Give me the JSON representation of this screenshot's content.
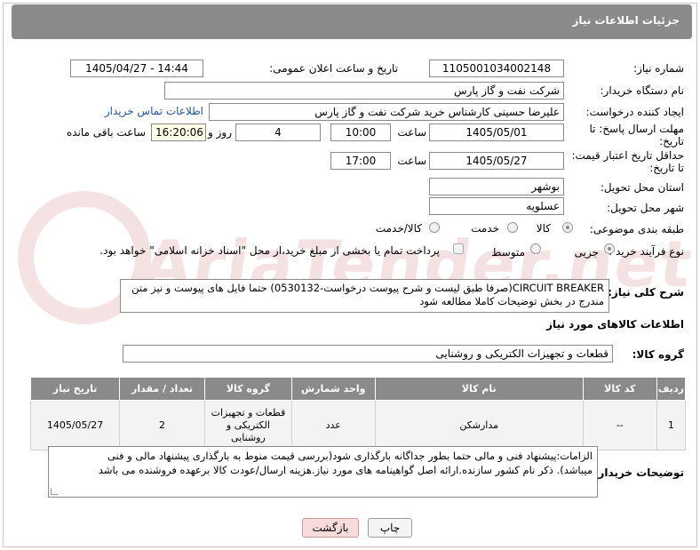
{
  "header": {
    "title": "جزئیات اطلاعات نیاز"
  },
  "watermark": {
    "text": "AriaTender.net"
  },
  "form": {
    "need_number": {
      "label": "شماره نیاز:",
      "value": "1105001034002148"
    },
    "announce_datetime": {
      "label": "تاریخ و ساعت اعلان عمومی:",
      "value": "1405/04/27 - 14:44"
    },
    "buyer_org": {
      "label": "نام دستگاه خریدار:",
      "value": "شرکت نفت و گاز پارس"
    },
    "requester": {
      "label": "ایجاد کننده درخواست:",
      "value": "علیرضا حسینی کارشناس خرید شرکت نفت و گاز پارس",
      "contact_link": "اطلاعات تماس خریدار"
    },
    "reply_deadline": {
      "label_line1": "مهلت ارسال پاسخ: تا",
      "label_line2": "تاریخ:",
      "date": "1405/05/01",
      "time_label": "ساعت",
      "time": "10:00",
      "days": "4",
      "days_label": "روز و",
      "remaining": "16:20:06",
      "remaining_label": "ساعت باقی مانده"
    },
    "price_validity": {
      "label_line1": "حداقل تاریخ اعتبار قیمت:",
      "label_line2": "تا تاریخ:",
      "date": "1405/05/27",
      "time_label": "ساعت",
      "time": "17:00"
    },
    "province": {
      "label": "استان محل تحویل:",
      "value": "بوشهر"
    },
    "city": {
      "label": "شهر محل تحویل:",
      "value": "عسلویه"
    },
    "category": {
      "label": "طبقه بندی موضوعی:",
      "options": [
        "کالا",
        "خدمت",
        "کالا/خدمت"
      ],
      "selected": "کالا"
    },
    "purchase_type": {
      "label": "نوع فرآیند خرید :",
      "options": [
        "جزیی",
        "متوسط"
      ],
      "selected": "جزیی",
      "payment_note": "پرداخت تمام یا بخشی از مبلغ خرید،از محل \"اسناد خزانه اسلامی\" خواهد بود."
    }
  },
  "description": {
    "label": "شرح کلی نیاز:",
    "value_line1": "CIRCUIT BREAKER(صرفا طبق لیست و شرح پیوست درخواست-0530132) حتما فایل های پیوست و نیز متن",
    "value_line2": "مندرج در بخش توضیحات کاملا مطالعه شود"
  },
  "goods_info": {
    "title": "اطلاعات کالاهای مورد نیاز",
    "group_label": "گروه کالا:",
    "group_value": "قطعات و تجهیزات الکتریکی و روشنایی"
  },
  "table": {
    "headers": [
      "ردیف",
      "کد کالا",
      "نام کالا",
      "واحد شمارش",
      "گروه کالا",
      "تعداد / مقدار",
      "تاریخ نیاز"
    ],
    "rows": [
      {
        "row": "1",
        "code": "--",
        "name": "مدارشکن",
        "unit": "عدد",
        "group": "قطعات و تجهیزات الکتریکی و روشنایی",
        "qty": "2",
        "date": "1405/05/27"
      }
    ]
  },
  "buyer_notes": {
    "label": "توضیحات خریدار:",
    "line1": "الزامات:پیشنهاد فنی و مالی حتما  بطور جداگانه بارگذاری شود(بررسی قیمت منوط به بارگذاری پیشنهاد مالی و فنی",
    "line2": "میباشد). ذکر نام کشور سازنده.ارائه اصل گواهینامه های مورد نیاز.هزینه ارسال/عودت کالا برعهده فروشنده می باشد"
  },
  "buttons": {
    "back": "بازگشت",
    "print": "چاپ"
  }
}
